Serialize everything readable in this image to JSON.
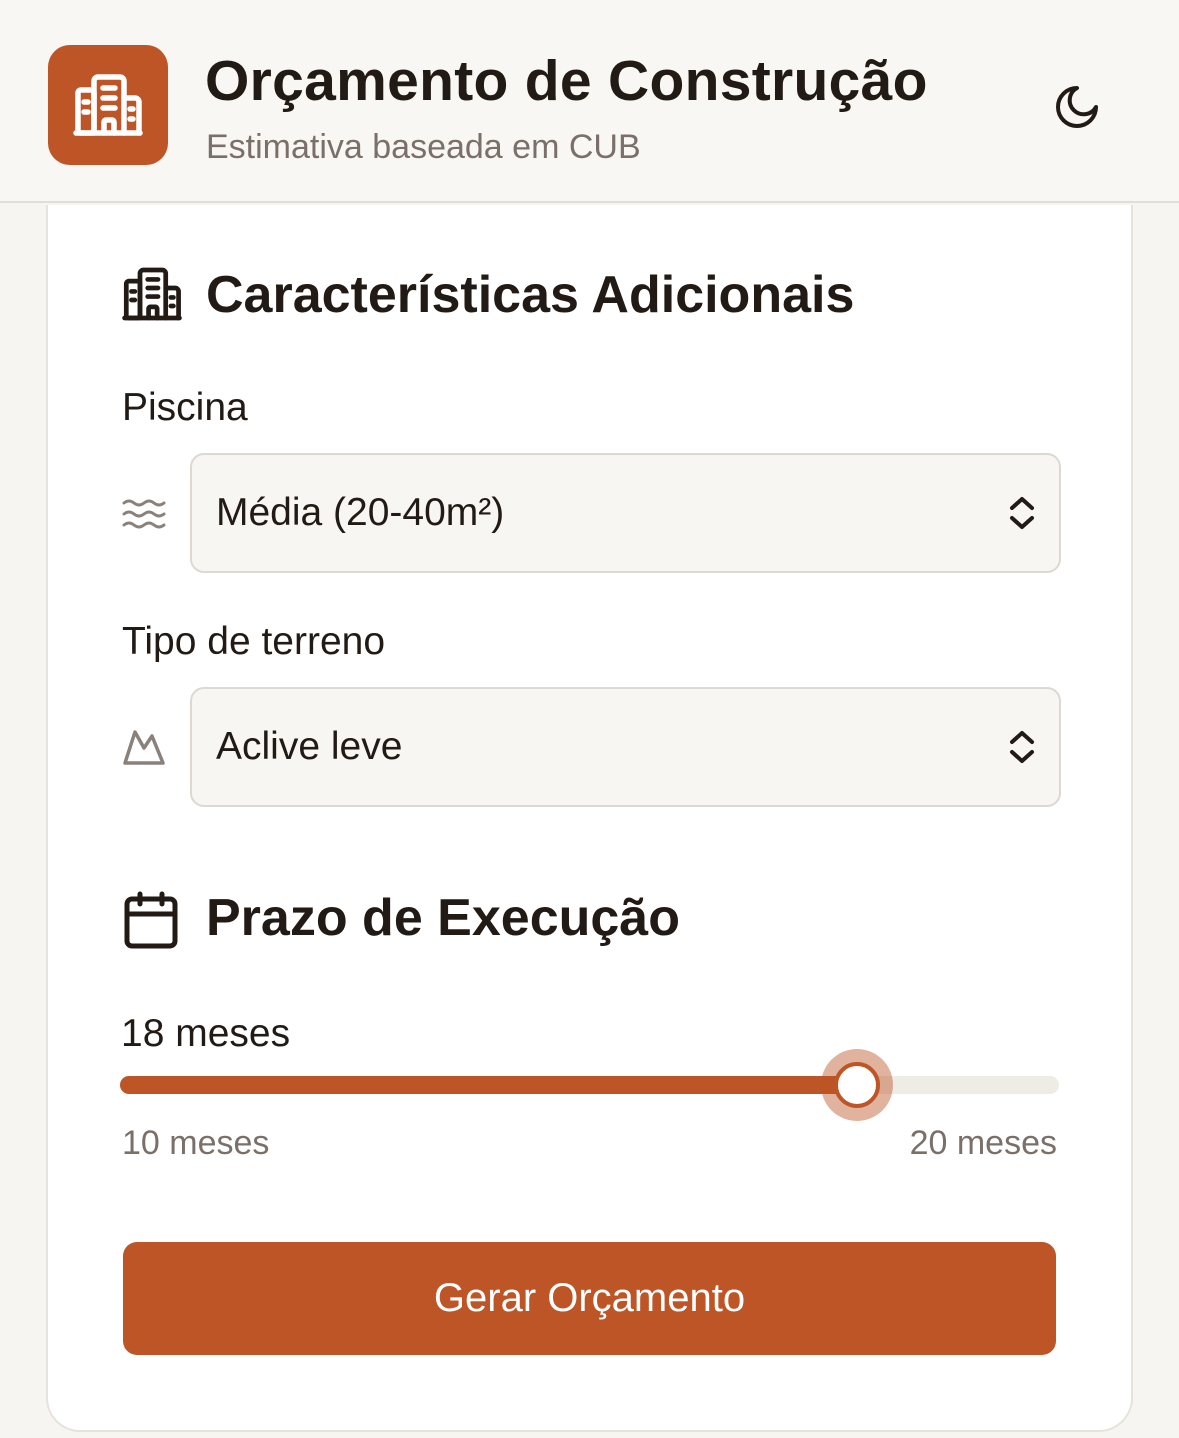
{
  "header": {
    "title": "Orçamento de Construção",
    "subtitle": "Estimativa baseada em CUB",
    "logo_icon": "building-icon",
    "theme_toggle_icon": "moon-icon"
  },
  "additional": {
    "title": "Características Adicionais",
    "icon": "building-icon",
    "pool": {
      "label": "Piscina",
      "icon": "waves-icon",
      "selected": "Média (20-40m²)"
    },
    "terrain": {
      "label": "Tipo de terreno",
      "icon": "mountain-icon",
      "selected": "Aclive leve"
    }
  },
  "schedule": {
    "title": "Prazo de Execução",
    "icon": "calendar-icon",
    "value_label": "18 meses",
    "value": 18,
    "min": 10,
    "max": 20,
    "min_label": "10 meses",
    "max_label": "20 meses"
  },
  "action": {
    "submit_label": "Gerar Orçamento"
  },
  "colors": {
    "accent": "#bd5526",
    "background": "#f7f5f1",
    "card": "#ffffff",
    "text": "#221a14",
    "muted": "#7a7069"
  }
}
